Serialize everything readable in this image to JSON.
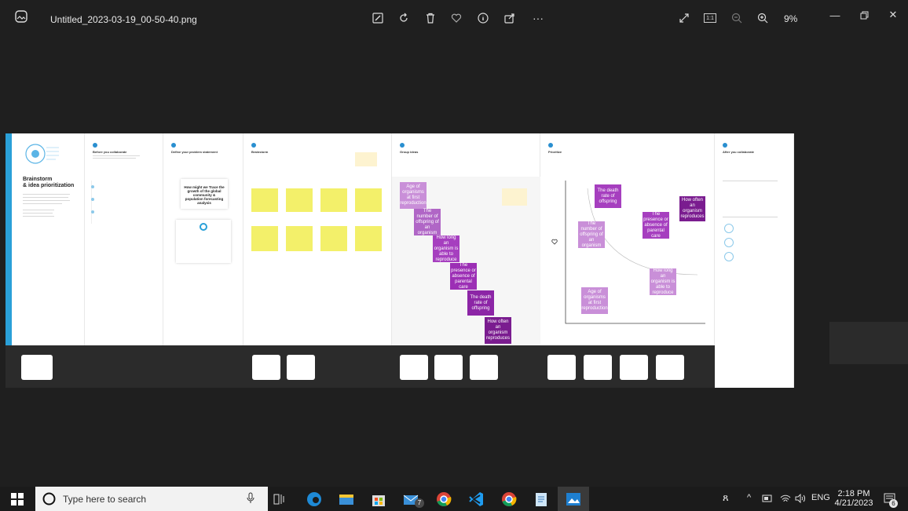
{
  "window": {
    "filename": "Untitled_2023-03-19_00-50-40.png",
    "zoom_level": "9%",
    "toolbar": [
      "edit-icon",
      "rotate-icon",
      "delete-icon",
      "favorite-icon",
      "info-icon",
      "share-icon",
      "more-icon"
    ],
    "more_label": "···",
    "actual_size_label": "1:1"
  },
  "board": {
    "title_line1": "Brainstorm",
    "title_line2": "& idea prioritization",
    "columns": [
      {
        "heading": "Before you collaborate"
      },
      {
        "heading": "Define your problem statement"
      },
      {
        "heading": "Brainstorm"
      },
      {
        "heading": "Group ideas"
      },
      {
        "heading": "Prioritize"
      },
      {
        "heading": "After you collaborate"
      }
    ],
    "problem_statement": "How might we Trace the growth of the global community & population forecasting analysis",
    "group_notes": [
      "Age of organisms at first reproduction",
      "The number of offspring of an organism",
      "How long an organism is able to reproduce",
      "The presence or absence of parental care",
      "The death rate of offspring",
      "How often an organism reproduces"
    ],
    "prioritize_notes": [
      "The death rate of offspring",
      "The number of offspring of an organism",
      "The presence or absence of parental care",
      "How often an organism reproduces",
      "How long an organism is able to reproduce",
      "Age of organisms at first reproduction"
    ]
  },
  "taskbar": {
    "search_placeholder": "Type here to search",
    "language": "ENG",
    "time": "2:18 PM",
    "date": "4/21/2023",
    "mail_badge": "7",
    "notification_badge": "6"
  },
  "colors": {
    "light_purple": "#c98fd8",
    "mid_purple": "#a63fbf",
    "dark_purple": "#7a1c8f",
    "sticky_yellow": "#f3f06a",
    "accent_blue": "#2aa0d8"
  }
}
